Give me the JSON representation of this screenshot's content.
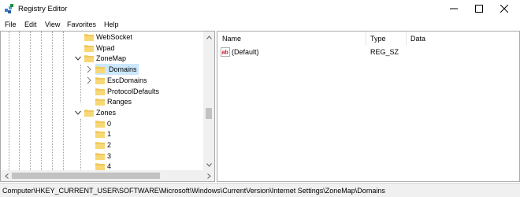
{
  "window": {
    "title": "Registry Editor"
  },
  "menu": [
    "File",
    "Edit",
    "View",
    "Favorites",
    "Help"
  ],
  "tree": {
    "items": [
      {
        "label": "WebSocket",
        "depth": 0
      },
      {
        "label": "Wpad",
        "depth": 0
      },
      {
        "label": "ZoneMap",
        "depth": 0,
        "expanded": true
      },
      {
        "label": "Domains",
        "depth": 1,
        "selected": true
      },
      {
        "label": "EscDomains",
        "depth": 1
      },
      {
        "label": "ProtocolDefaults",
        "depth": 1
      },
      {
        "label": "Ranges",
        "depth": 1
      },
      {
        "label": "Zones",
        "depth": 0,
        "expanded": true
      },
      {
        "label": "0",
        "depth": 1
      },
      {
        "label": "1",
        "depth": 1
      },
      {
        "label": "2",
        "depth": 1
      },
      {
        "label": "3",
        "depth": 1
      },
      {
        "label": "4",
        "depth": 1
      }
    ]
  },
  "list": {
    "columns": [
      "Name",
      "Type",
      "Data"
    ],
    "rows": [
      {
        "name": "(Default)",
        "type": "REG_SZ",
        "data": ""
      }
    ]
  },
  "status": {
    "path": "Computer\\HKEY_CURRENT_USER\\SOFTWARE\\Microsoft\\Windows\\CurrentVersion\\Internet Settings\\ZoneMap\\Domains"
  },
  "colors": {
    "folder": "#f8d775",
    "folder_dark": "#e2b33c",
    "selection": "#cce8ff",
    "reg_icon": "#c8102e"
  },
  "icons": {
    "app": "registry-editor-icon",
    "minimize": "minimize-icon",
    "maximize": "maximize-icon",
    "close": "close-icon",
    "folder": "folder-icon",
    "string_value": "string-value-icon"
  }
}
